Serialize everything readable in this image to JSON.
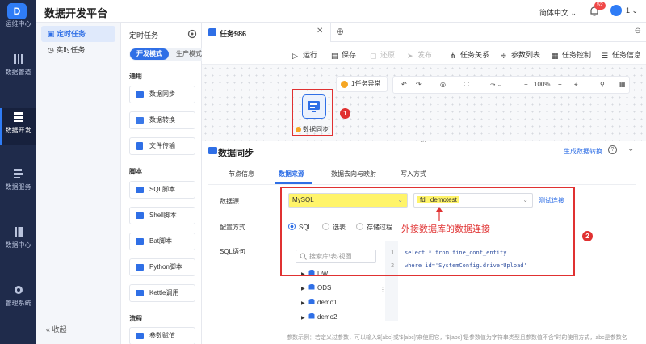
{
  "app": {
    "title": "数据开发平台",
    "logo_letter": "D"
  },
  "rail": {
    "items": [
      {
        "label": "运维中心"
      },
      {
        "label": "数据管道"
      },
      {
        "label": "数据开发"
      },
      {
        "label": "数据服务"
      },
      {
        "label": "数据中心"
      },
      {
        "label": "管理系统"
      }
    ]
  },
  "header": {
    "language": "简体中文",
    "notification_count": "52",
    "user": "1"
  },
  "side2": {
    "items": [
      {
        "label": "定时任务"
      },
      {
        "label": "实时任务"
      }
    ],
    "collapse": "收起"
  },
  "panel": {
    "title": "定时任务",
    "mode_dev": "开发模式",
    "mode_prod": "生产模式",
    "groups": {
      "general": "通用",
      "script": "脚本",
      "flow": "流程"
    },
    "components": [
      {
        "label": "数据同步"
      },
      {
        "label": "数据转换"
      },
      {
        "label": "文件传输"
      },
      {
        "label": "SQL脚本"
      },
      {
        "label": "Shell脚本"
      },
      {
        "label": "Bat脚本"
      },
      {
        "label": "Python脚本"
      },
      {
        "label": "Kettle调用"
      },
      {
        "label": "参数赋值"
      }
    ]
  },
  "tab": {
    "label": "任务986"
  },
  "toolbar": {
    "run": "运行",
    "save": "保存",
    "revert": "还原",
    "publish": "发布",
    "relation": "任务关系",
    "params": "参数列表",
    "control": "任务控制",
    "info": "任务信息"
  },
  "canvas": {
    "warning": "1任务异常",
    "zoom": "100%",
    "node_label": "数据同步",
    "badge1": "1"
  },
  "config": {
    "title": "数据同步",
    "preview_link": "生成数据转换",
    "tabs": [
      {
        "label": "节点信息"
      },
      {
        "label": "数据来源"
      },
      {
        "label": "数据去向与映射"
      },
      {
        "label": "写入方式"
      }
    ],
    "datasource_label": "数据源",
    "datasource_type": "MySQL",
    "datasource_conn": "fdl_demotest",
    "test_link": "测试连接",
    "annotation": "外接数据库的数据连接",
    "badge2": "2",
    "config_mode_label": "配置方式",
    "modes": [
      {
        "label": "SQL"
      },
      {
        "label": "选表"
      },
      {
        "label": "存储过程"
      }
    ],
    "sql_label": "SQL语句",
    "search_placeholder": "搜索库/表/视图",
    "tree": [
      {
        "label": "DW"
      },
      {
        "label": "ODS"
      },
      {
        "label": "demo1"
      },
      {
        "label": "demo2"
      }
    ],
    "code_lines": [
      {
        "n": "1",
        "text": "select * from fine_conf_entity"
      },
      {
        "n": "2",
        "text": "where id='SystemConfig.driverUpload'"
      }
    ],
    "footnote": "参数示例：若定义过参数，可以输入${abc}或'${abc}'来使用它，'${abc}'是参数值为字符串类型且参数值不含\"时的使用方式，abc是参数名"
  },
  "colors": {
    "accent": "#2f6fe6",
    "annotation_red": "#e03131",
    "highlight": "#fff46a",
    "rail_bg": "#1f2b4b"
  }
}
